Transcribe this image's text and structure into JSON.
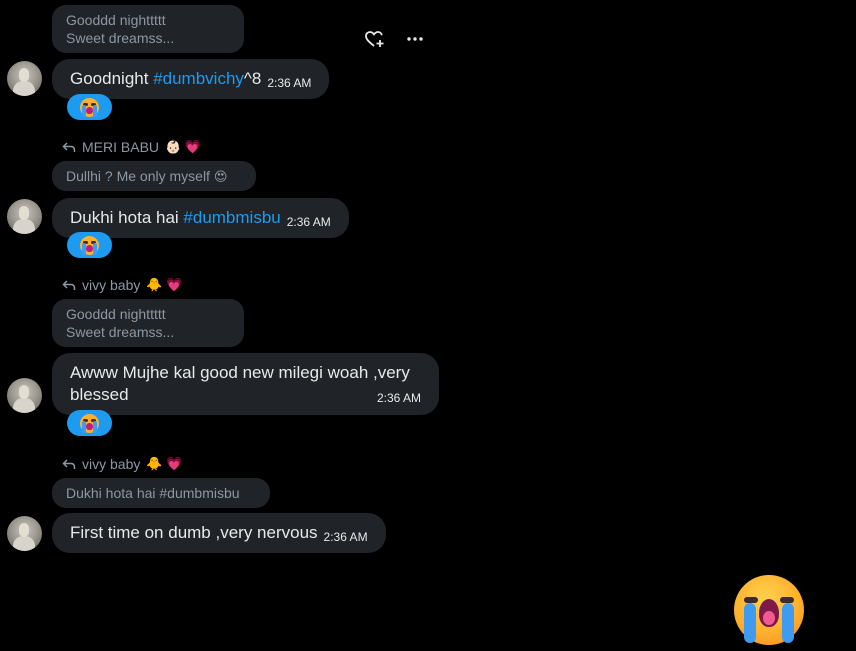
{
  "messages": [
    {
      "quote": [
        "Gooddd nighttttt",
        "Sweet dreamss..."
      ],
      "text": "Goodnight ",
      "hashtag": "#dumbvichy",
      "suffix": "^8",
      "time": "2:36 AM",
      "reaction": "crying-face"
    },
    {
      "reply_to": "MERI BABU",
      "reply_emojis": "👶🏻 💗",
      "quote_text": "Dullhi ? Me only myself",
      "quote_emoji": "😍",
      "text": "Dukhi hota hai ",
      "hashtag": "#dumbmisbu",
      "time": "2:36 AM",
      "reaction": "crying-face"
    },
    {
      "reply_to": "vivy baby",
      "reply_emojis": "🐥 💗",
      "quote": [
        "Gooddd nighttttt",
        "Sweet dreamss..."
      ],
      "text_lines": [
        "Awww Mujhe kal good new milegi woah ,very",
        "blessed"
      ],
      "time": "2:36 AM",
      "reaction": "crying-face"
    },
    {
      "reply_to": "vivy baby",
      "reply_emojis": "🐥 💗",
      "quote_text": "Dukhi hota hai #dumbmisbu",
      "text": "First time on dumb ,very nervous",
      "time": "2:36 AM"
    }
  ],
  "icons": {
    "react": "heart-plus-icon",
    "more": "more-icon",
    "reply": "reply-arrow-icon",
    "floating": "crying-face-icon"
  },
  "colors": {
    "background": "#000000",
    "bubble": "#202327",
    "accent": "#1d9bf0",
    "muted": "#8b98a5"
  }
}
